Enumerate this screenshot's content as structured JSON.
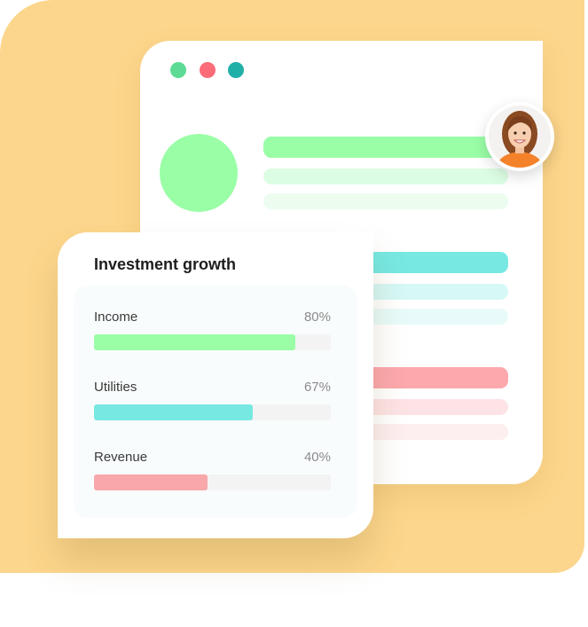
{
  "colors": {
    "background_yellow": "#fcd68c",
    "dot_green": "#5ddb94",
    "dot_red": "#fb6b78",
    "dot_teal": "#20b0a8",
    "green": "#9afea7",
    "green_light": "#dcfde3",
    "green_lighter": "#ecfdf0",
    "teal": "#77e9e2",
    "teal_light": "#d6f8f6",
    "teal_lighter": "#e8fbfa",
    "red": "#fca8ad",
    "red_light": "#fde3e5",
    "red_lighter": "#fdeeef"
  },
  "window": {
    "traffic_lights": [
      "close",
      "minimize",
      "maximize"
    ]
  },
  "profile": {
    "icon": "user-avatar-photo"
  },
  "card": {
    "title": "Investment growth",
    "rows": [
      {
        "label": "Income",
        "value": "80%",
        "fraction": 0.85,
        "color": "#9afea7"
      },
      {
        "label": "Utilities",
        "value": "67%",
        "fraction": 0.67,
        "color": "#77e9e2"
      },
      {
        "label": "Revenue",
        "value": "40%",
        "fraction": 0.48,
        "color": "#f8a8ab"
      }
    ]
  }
}
